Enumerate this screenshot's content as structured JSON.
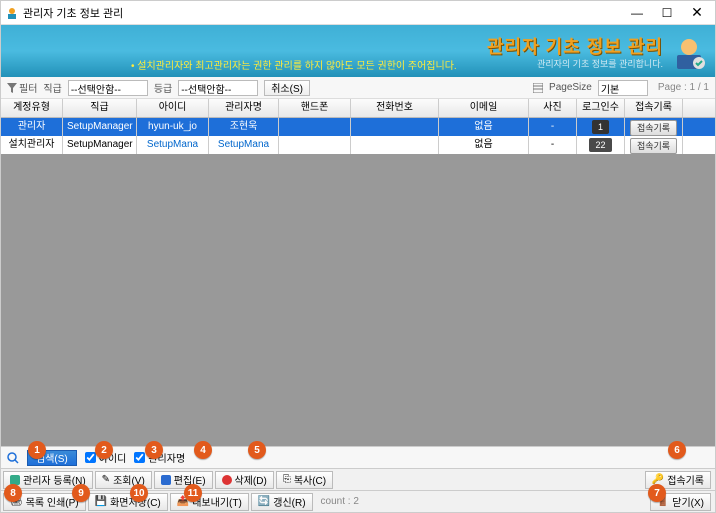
{
  "window": {
    "title": "관리자 기초 정보 관리"
  },
  "banner": {
    "title": "관리자 기초 정보 관리",
    "subtitle": "관리자의 기초 정보를 관리합니다.",
    "warning": "• 설치관리자와 최고관리자는 권한 관리를 하지 않아도 모든 권한이 주어집니다."
  },
  "filter": {
    "filter_label": "필터",
    "rank_label": "직급",
    "rank_value": "--선택안함--",
    "grade_label": "등급",
    "grade_value": "--선택안함--",
    "cancel_label": "취소(S)",
    "pagesize_label": "PageSize",
    "pagesize_value": "기본",
    "page_info": "Page :  1 / 1"
  },
  "grid": {
    "headers": [
      "계정유형",
      "직급",
      "아이디",
      "관리자명",
      "핸드폰",
      "전화번호",
      "이메일",
      "사진",
      "로그인수",
      "접속기록"
    ],
    "rows": [
      {
        "type": "관리자",
        "rank": "SetupManager",
        "id": "hyun-uk_jo",
        "name": "조현욱",
        "phone": "",
        "tel": "",
        "email": "없음",
        "photo": "-",
        "logins": "1",
        "log_btn": "접속기록"
      },
      {
        "type": "설치관리자",
        "rank": "SetupManager",
        "id": "SetupMana",
        "name": "SetupMana",
        "phone": "",
        "tel": "",
        "email": "없음",
        "photo": "-",
        "logins": "22",
        "log_btn": "접속기록"
      }
    ]
  },
  "search": {
    "button_label": "검색(S)",
    "chk_id": "아이디",
    "chk_name": "관리자명"
  },
  "toolbar1": {
    "b1": "관리자 등록(N)",
    "b2": "조회(V)",
    "b3": "편집(E)",
    "b4": "삭제(D)",
    "b5": "복사(C)",
    "b6": "접속기록"
  },
  "toolbar2": {
    "b1": "목록 인쇄(P)",
    "b2": "화면저장(C)",
    "b3": "내보내기(T)",
    "b4": "갱신(R)",
    "count": "count : 2",
    "close": "닫기(X)"
  },
  "annotations": [
    "1",
    "2",
    "3",
    "4",
    "5",
    "6",
    "7",
    "8",
    "9",
    "10",
    "11"
  ]
}
